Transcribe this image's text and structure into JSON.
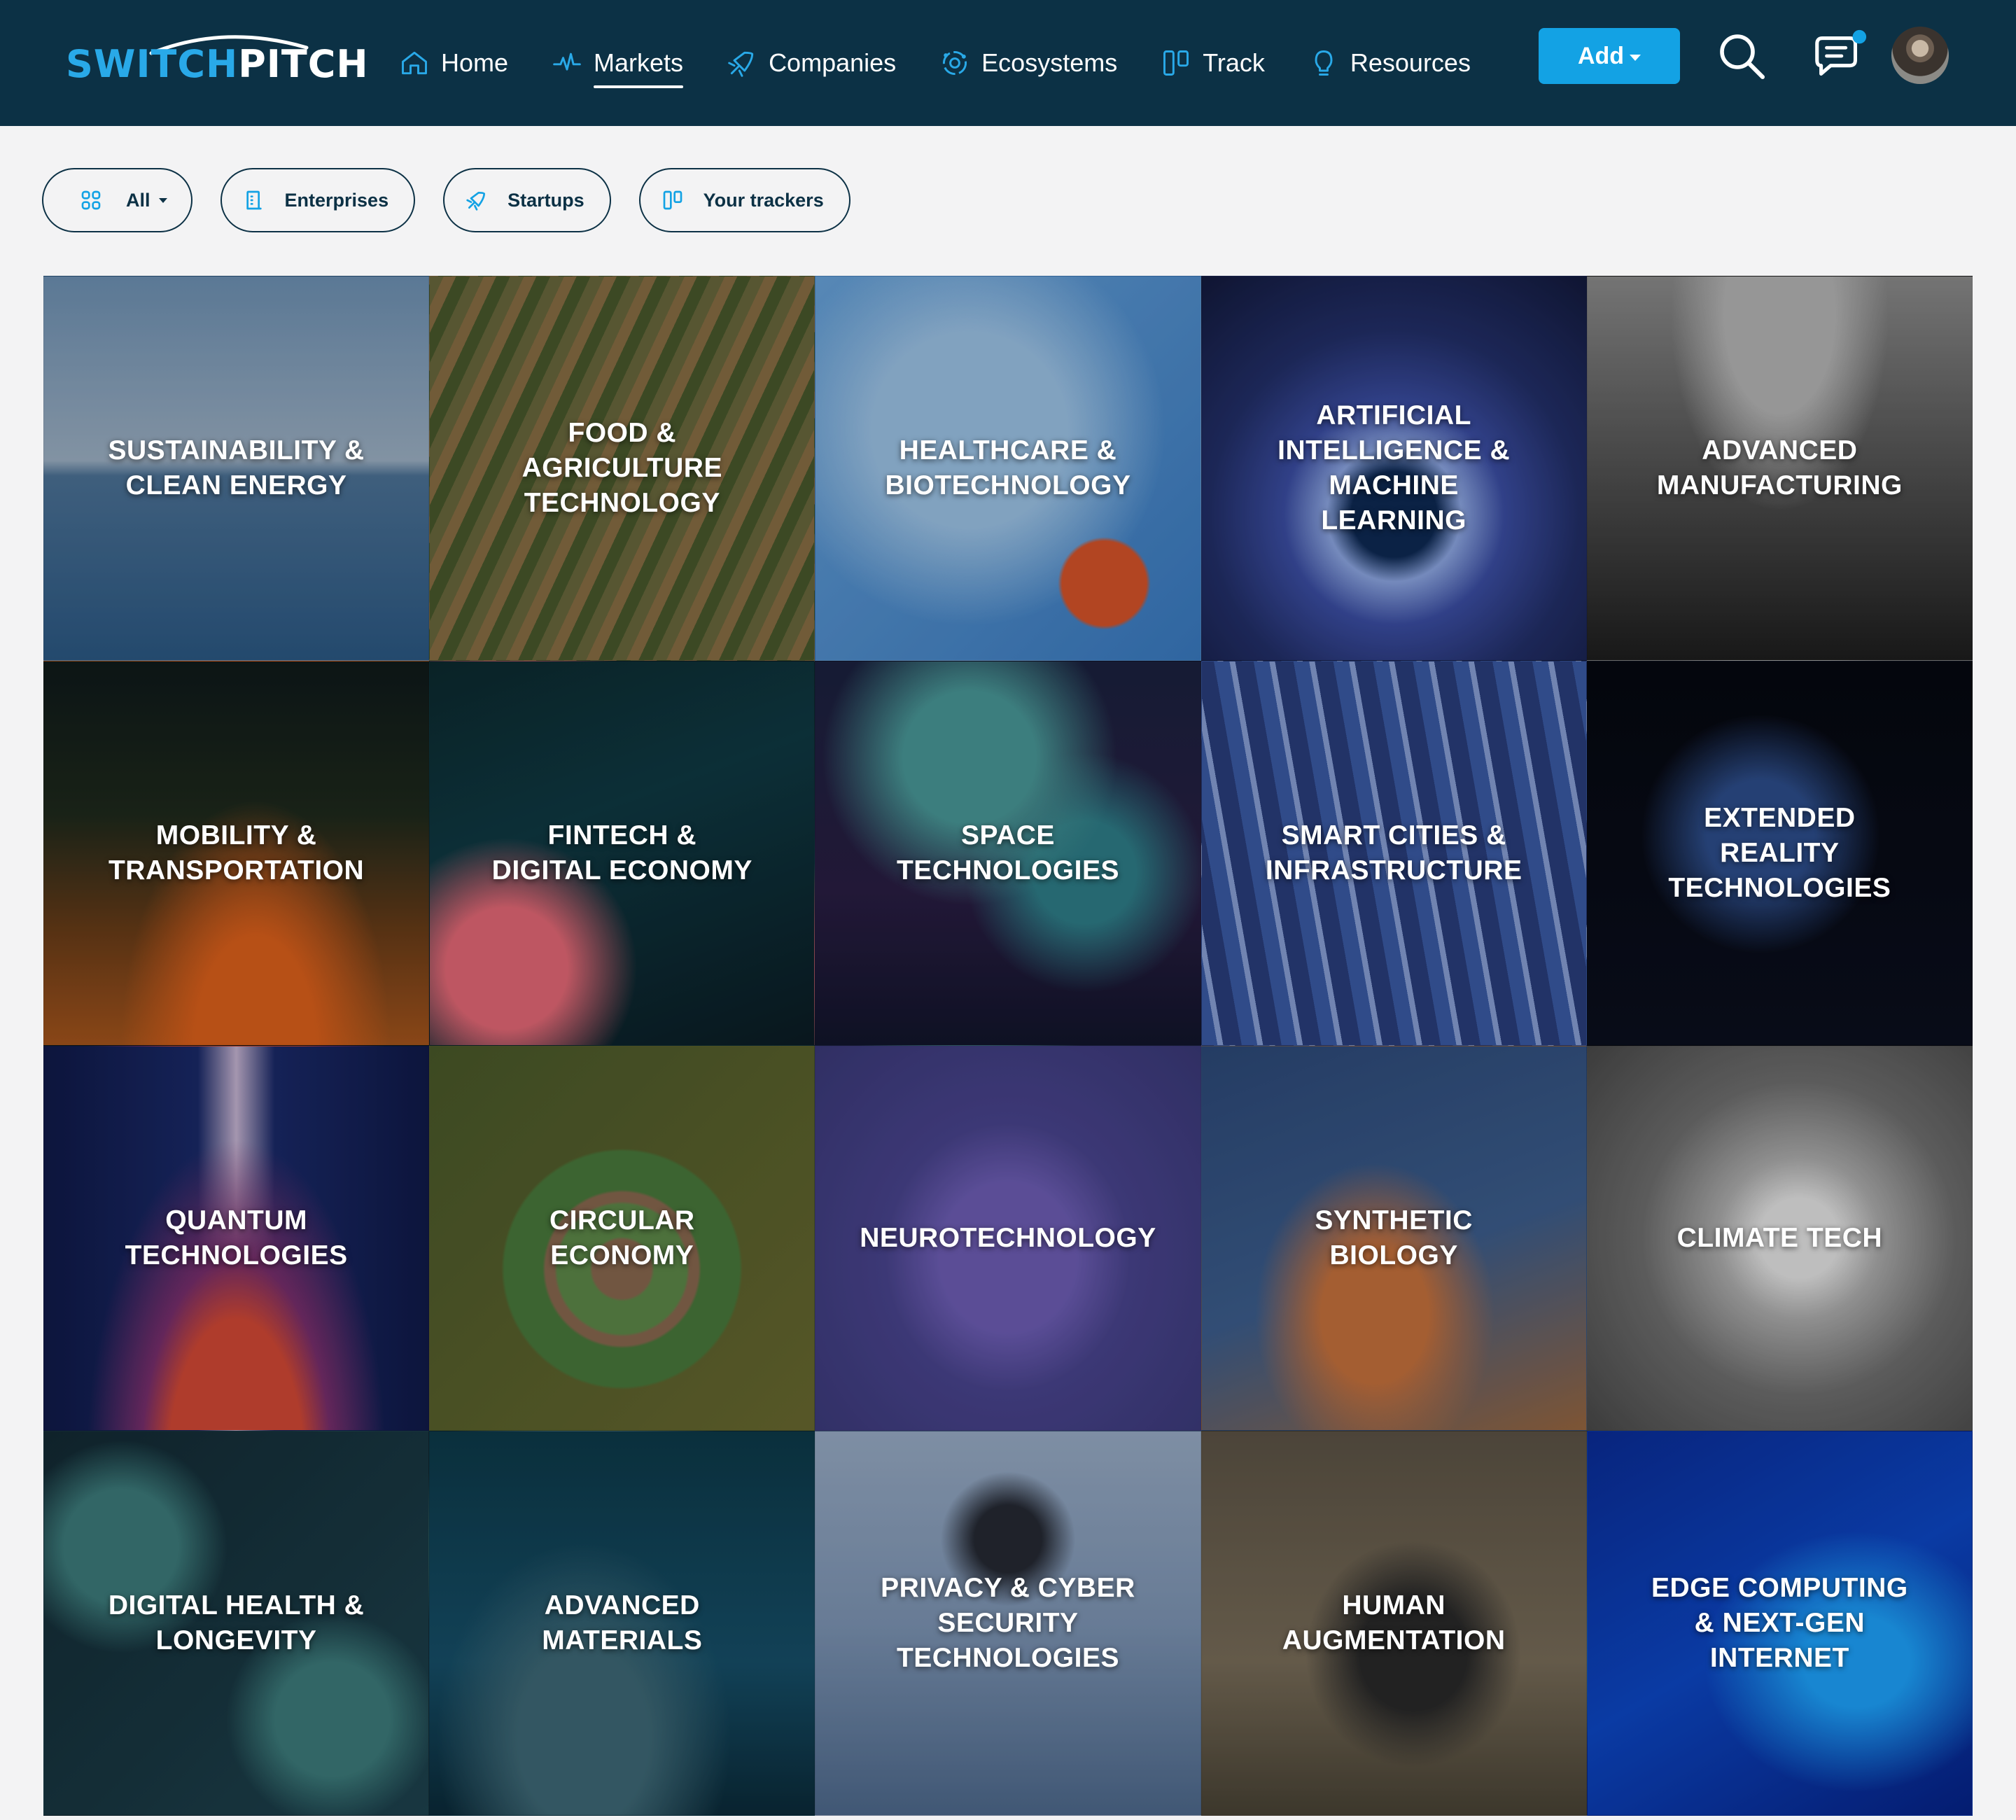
{
  "brand": {
    "part1": "SWITCH",
    "part2": "PITCH"
  },
  "nav": [
    {
      "label": "Home",
      "icon": "home-icon"
    },
    {
      "label": "Markets",
      "icon": "pulse-icon",
      "active": true
    },
    {
      "label": "Companies",
      "icon": "rocket-icon"
    },
    {
      "label": "Ecosystems",
      "icon": "network-icon"
    },
    {
      "label": "Track",
      "icon": "kanban-icon"
    },
    {
      "label": "Resources",
      "icon": "lightbulb-icon"
    }
  ],
  "header": {
    "add_label": "Add"
  },
  "chips": [
    {
      "label": "All",
      "icon": "grid-icon"
    },
    {
      "label": "Enterprises",
      "icon": "building-icon"
    },
    {
      "label": "Startups",
      "icon": "rocket-icon"
    },
    {
      "label": "Your trackers",
      "icon": "kanban-icon"
    }
  ],
  "markets": [
    "SUSTAINABILITY & CLEAN ENERGY",
    "FOOD & AGRICULTURE TECHNOLOGY",
    "HEALTHCARE & BIOTECHNOLOGY",
    "ARTIFICIAL INTELLIGENCE & MACHINE LEARNING",
    "ADVANCED MANUFACTURING",
    "MOBILITY & TRANSPORTATION",
    "FINTECH & DIGITAL ECONOMY",
    "SPACE TECHNOLOGIES",
    "SMART CITIES & INFRASTRUCTURE",
    "EXTENDED REALITY TECHNOLOGIES",
    "QUANTUM TECHNOLOGIES",
    "CIRCULAR ECONOMY",
    "NEUROTECHNOLOGY",
    "SYNTHETIC BIOLOGY",
    "CLIMATE TECH",
    "DIGITAL HEALTH & LONGEVITY",
    "ADVANCED MATERIALS",
    "PRIVACY & CYBER SECURITY TECHNOLOGIES",
    "HUMAN AUGMENTATION",
    "EDGE COMPUTING & NEXT-GEN INTERNET"
  ],
  "colors": {
    "header_bg": "#0c3145",
    "accent": "#13a2e4",
    "brand_accent": "#29a9e8",
    "page_bg": "#f3f3f4"
  }
}
